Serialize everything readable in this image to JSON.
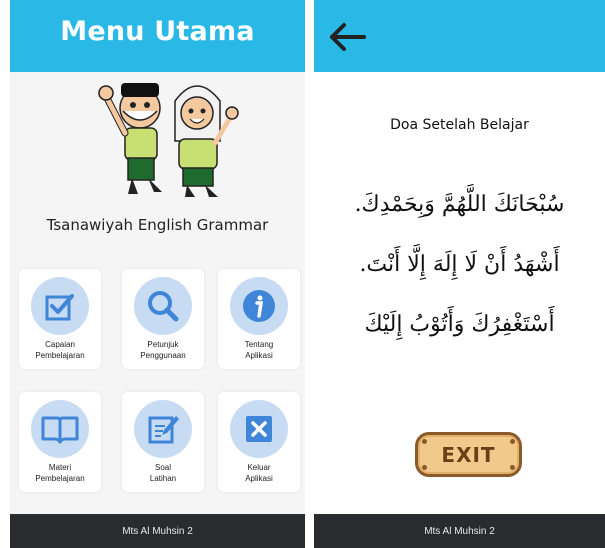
{
  "left_screen": {
    "header": {
      "title": "Menu Utama"
    },
    "subtitle": "Tsanawiyah English Grammar",
    "menu_items": [
      {
        "label": "Capaian\nPembelajaran",
        "icon": "checkbox-icon"
      },
      {
        "label": "Petunjuk\nPenggunaan",
        "icon": "search-icon"
      },
      {
        "label": "Tentang\nAplikasi",
        "icon": "info-icon"
      },
      {
        "label": "Materi\nPembelajaran",
        "icon": "book-icon"
      },
      {
        "label": "Soal\nLatihan",
        "icon": "edit-icon"
      },
      {
        "label": "Keluar\nAplikasi",
        "icon": "close-icon"
      }
    ],
    "footer": "Mts Al Muhsin 2"
  },
  "right_screen": {
    "header": {
      "back_icon": "arrow-left-icon"
    },
    "doa_title": "Doa Setelah Belajar",
    "arabic_lines": [
      "سُبْحَانَكَ اللَّهُمَّ وَبِحَمْدِكَ.",
      "أَشْهَدُ أَنْ لَا إِلَهَ إِلَّا أَنْتَ.",
      "أَسْتَغْفِرُكَ وَأَتُوْبُ إِلَيْكَ"
    ],
    "exit_label": "EXIT",
    "footer": "Mts Al Muhsin 2"
  },
  "colors": {
    "header": "#2ab8e6",
    "footer": "#2a2b2f",
    "icon_circle": "#c7dcf3",
    "icon": "#3f86d9",
    "exit_button": "#f0c98b"
  }
}
